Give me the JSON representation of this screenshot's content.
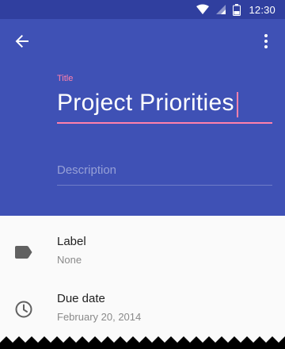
{
  "status_bar": {
    "time": "12:30",
    "icons": [
      "wifi-icon",
      "signal-icon",
      "battery-icon"
    ],
    "background": "#303f9f"
  },
  "header": {
    "background": "#3f51b5",
    "back_icon": "arrow-back-icon",
    "menu_icon": "more-vert-icon",
    "title_field": {
      "label": "Title",
      "value": "Project Priorities",
      "accent": "#ff80ab",
      "focused": true
    },
    "description_field": {
      "placeholder": "Description",
      "value": ""
    }
  },
  "details": [
    {
      "icon": "label-tag-icon",
      "title": "Label",
      "value": "None"
    },
    {
      "icon": "clock-icon",
      "title": "Due date",
      "value": "February 20, 2014"
    }
  ]
}
